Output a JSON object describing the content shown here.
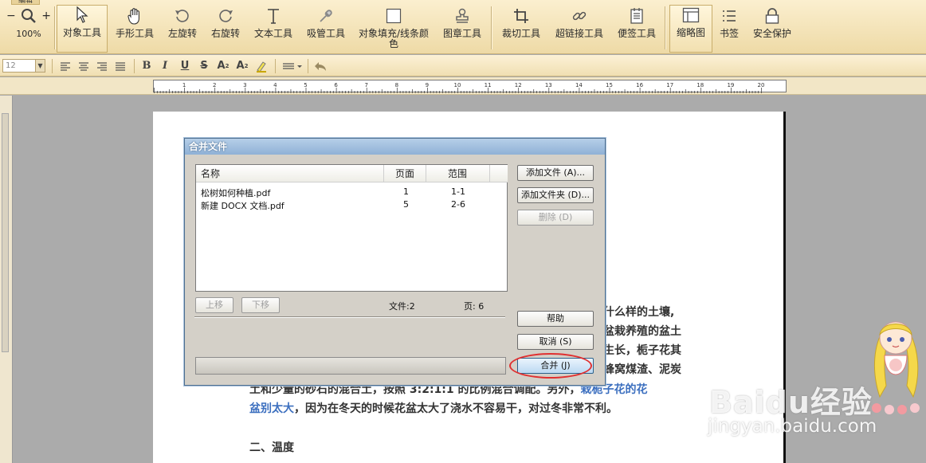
{
  "tab_label": "编辑",
  "toolbar": {
    "zoom": "100%",
    "tools": [
      {
        "label": "对象工具",
        "icon": "cursor-arrow-icon",
        "active": true
      },
      {
        "label": "手形工具",
        "icon": "hand-icon"
      },
      {
        "label": "左旋转",
        "icon": "rotate-left-icon"
      },
      {
        "label": "右旋转",
        "icon": "rotate-right-icon"
      },
      {
        "label": "文本工具",
        "icon": "text-tool-icon"
      },
      {
        "label": "吸管工具",
        "icon": "eyedropper-icon"
      },
      {
        "label": "对象填充/线条颜色",
        "icon": "fill-color-icon"
      },
      {
        "label": "图章工具",
        "icon": "stamp-icon"
      },
      {
        "label": "裁切工具",
        "icon": "crop-icon"
      },
      {
        "label": "超链接工具",
        "icon": "hyperlink-icon"
      },
      {
        "label": "便签工具",
        "icon": "note-icon"
      },
      {
        "label": "缩略图",
        "icon": "thumbnail-icon",
        "active": true
      },
      {
        "label": "书签",
        "icon": "bookmark-list-icon"
      },
      {
        "label": "安全保护",
        "icon": "lock-icon"
      }
    ]
  },
  "format_bar": {
    "font_size": "12",
    "buttons": [
      "B",
      "I",
      "U",
      "S",
      "A",
      "A"
    ]
  },
  "ruler_labels": [
    "1",
    "2",
    "3",
    "4",
    "5",
    "6",
    "7",
    "8",
    "9",
    "10",
    "11",
    "12",
    "13",
    "14",
    "15",
    "16",
    "17",
    "18",
    "19",
    "20"
  ],
  "document": {
    "lines": [
      {
        "text": "什么样的土壤,",
        "blue": ""
      },
      {
        "text": "盆栽养殖的盆土",
        "blue": ""
      },
      {
        "text": "生长，栀子花其",
        "blue": ""
      },
      {
        "text": "蜂窝煤渣、泥炭",
        "blue": ""
      },
      {
        "text": "土和少量的砂石的混合土，按照 3:2:1:1 的比例混合调配。另外，",
        "blue": "栽栀子花的花"
      },
      {
        "text": "，因为在冬天的时候花盆太大了浇水不容易干，对过冬非常不利。",
        "blue": "盆别太大",
        "blue_first": true
      },
      {
        "text": "二、温度",
        "blue": ""
      }
    ]
  },
  "dialog": {
    "title": "合并文件",
    "columns": [
      "名称",
      "页面",
      "范围"
    ],
    "files": [
      {
        "name": "松树如何种植.pdf",
        "pages": "1",
        "range": "1-1"
      },
      {
        "name": "新建 DOCX 文档.pdf",
        "pages": "5",
        "range": "2-6"
      }
    ],
    "buttons": {
      "add_file": "添加文件 (A)...",
      "add_folder": "添加文件夹 (D)...",
      "delete": "删除 (D)",
      "move_up": "上移",
      "move_down": "下移",
      "help": "帮助",
      "cancel": "取消 (S)",
      "merge": "合并 (J)"
    },
    "file_count_label": "文件:2",
    "page_count_label": "页: 6"
  },
  "watermark": {
    "text": "Baidu经验",
    "sub": "jingyan.baidu.com"
  },
  "colors": {
    "toolbar_bg": "#f3e3b8",
    "dialog_bg": "#d4d0c8",
    "title_bar": "#9ab9db",
    "highlight_ring": "#e03030",
    "link_blue": "#3c6fbf"
  }
}
